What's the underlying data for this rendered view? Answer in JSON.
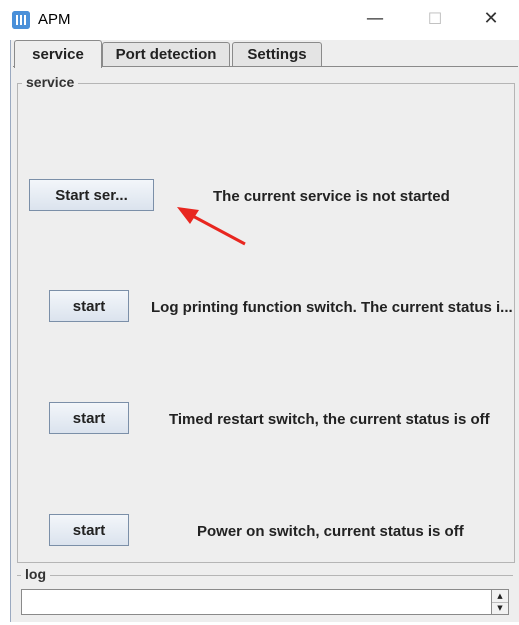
{
  "window": {
    "title": "APM",
    "icon_text": "",
    "minimize": "—",
    "maximize": "☐",
    "close": "✕"
  },
  "tabs": [
    {
      "label": "service",
      "active": true
    },
    {
      "label": "Port detection",
      "active": false
    },
    {
      "label": "Settings",
      "active": false
    }
  ],
  "service_group": {
    "title": "service",
    "main_button": "Start ser...",
    "main_status": "The current service is not started",
    "rows": [
      {
        "button": "start",
        "status": "Log printing function switch. The current status i..."
      },
      {
        "button": "start",
        "status": "Timed restart switch, the current status is off"
      },
      {
        "button": "start",
        "status": "Power on switch, current status is off"
      }
    ]
  },
  "log_group": {
    "title": "log",
    "value": ""
  },
  "colors": {
    "annotation_arrow": "#e8261f",
    "app_icon": "#4a90d9"
  }
}
